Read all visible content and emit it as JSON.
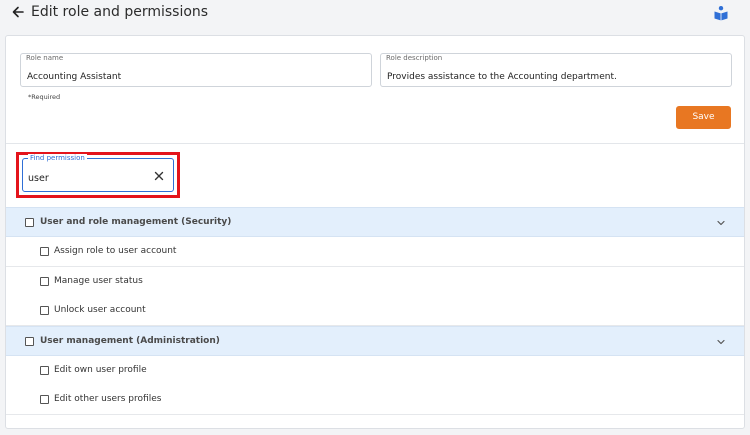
{
  "header": {
    "title": "Edit role and permissions"
  },
  "form": {
    "role_name": {
      "label": "Role name",
      "value": "Accounting Assistant"
    },
    "role_description": {
      "label": "Role description",
      "value": "Provides assistance to the Accounting department."
    },
    "required_note": "*Required",
    "save_label": "Save"
  },
  "search": {
    "label": "Find permission",
    "value": "user"
  },
  "groups": [
    {
      "label": "User and role management (Security)",
      "items": [
        {
          "label": "Assign role to user account"
        },
        {
          "label": "Manage user status"
        },
        {
          "label": "Unlock user account"
        }
      ]
    },
    {
      "label": "User management (Administration)",
      "items": [
        {
          "label": "Edit own user profile"
        },
        {
          "label": "Edit other users profiles"
        }
      ]
    }
  ],
  "colors": {
    "accent": "#e87722",
    "focus": "#2f6fd6",
    "highlight": "#e4141b",
    "group_bg": "#e3effc"
  },
  "icons": [
    "back-arrow-icon",
    "help-book-icon",
    "clear-icon",
    "chevron-down-icon",
    "checkbox"
  ]
}
